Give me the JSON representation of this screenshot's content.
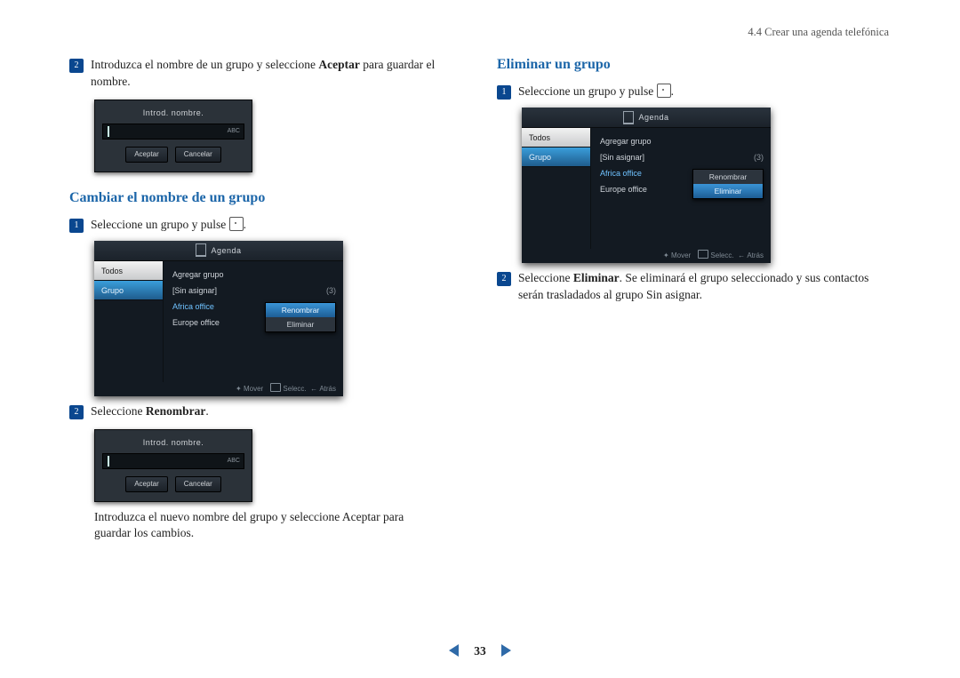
{
  "header": "4.4 Crear una agenda telefónica",
  "page_number": "33",
  "left": {
    "step2_top": {
      "n": "2",
      "text_a": "Introduzca el nombre de un grupo y seleccione ",
      "bold": "Aceptar",
      "text_b": " para guardar el nombre."
    },
    "h2": "Cambiar el nombre de un grupo",
    "step1": {
      "n": "1",
      "text": "Seleccione un grupo y pulse "
    },
    "step2_bottom": {
      "n": "2",
      "text_a": "Seleccione ",
      "bold": "Renombrar",
      "text_b": "."
    },
    "tail": "Introduzca el nuevo nombre del grupo y seleccione Aceptar para guardar los cambios."
  },
  "right": {
    "h2": "Eliminar un grupo",
    "step1": {
      "n": "1",
      "text": "Seleccione un grupo y pulse "
    },
    "step2": {
      "n": "2",
      "text_a": "Seleccione ",
      "bold": "Eliminar",
      "text_b": ". Se eliminará el grupo seleccionado y sus contactos serán trasladados al grupo Sin asignar."
    }
  },
  "input_panel": {
    "label": "Introd. nombre.",
    "abc": "ABC",
    "accept": "Aceptar",
    "cancel": "Cancelar"
  },
  "agenda": {
    "title": "Agenda",
    "tab_all": "Todos",
    "tab_group": "Grupo",
    "items": {
      "add": "Agregar grupo",
      "unassigned_l": "[Sin asignar]",
      "unassigned_r": "(3)",
      "africa": "Africa office",
      "europe": "Europe office"
    },
    "ctx": {
      "rename": "Renombrar",
      "delete": "Eliminar"
    },
    "footer": {
      "move": "Mover",
      "select": "Selecc.",
      "back": "Atrás"
    }
  }
}
